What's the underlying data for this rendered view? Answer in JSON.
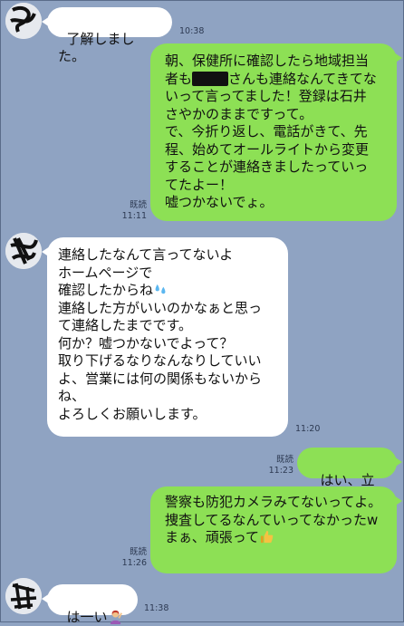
{
  "messages": [
    {
      "id": "m1",
      "side": "in",
      "text": "了解しました。",
      "time": "10:38"
    },
    {
      "id": "m2",
      "side": "out",
      "line1_pre": "朝、保健所に確認したら地域担当",
      "line2_pre": "者も",
      "line2_post": "さんも連絡なんてきてな",
      "text_rest": "いって言ってました！登録は石井\nさやかのままですって。\nで、今折り返し、電話がきて、先\n程、始めてオールライトから変更\nすることが連絡きましたっていっ\nてたよー！\n嘘つかないでょ。",
      "read": "既読",
      "time": "11:11"
    },
    {
      "id": "m3",
      "side": "in",
      "text_a": "連絡したなんて言ってないよ\nホームページで\n確認したからね",
      "text_b": "\n連絡した方がいいのかなぁと思っ\nて連絡したまでです。\n何か？嘘つかないでよって？\n取り下げるなりなんなりしていい\nよ、営業には何の関係もないから\nね、\nよろしくお願いします。",
      "time": "11:20"
    },
    {
      "id": "m4",
      "side": "out",
      "text": "はい、立派",
      "read": "既読",
      "time": "11:23"
    },
    {
      "id": "m5",
      "side": "out",
      "text_a": "警察も防犯カメラみてないってよ。捜査してるなんていってなかったw\nまぁ、頑張って",
      "read": "既読",
      "time": "11:26"
    },
    {
      "id": "m6",
      "side": "in",
      "text": "は一い",
      "time": "11:38"
    }
  ],
  "icons": {
    "sweat_drops": "sweat-droplets-icon",
    "thumbs_up": "thumbs-up-icon",
    "person_gesture": "person-gesturing-icon"
  },
  "colors": {
    "background": "#8fa3c2",
    "outgoing": "#8de055",
    "incoming": "#ffffff"
  }
}
